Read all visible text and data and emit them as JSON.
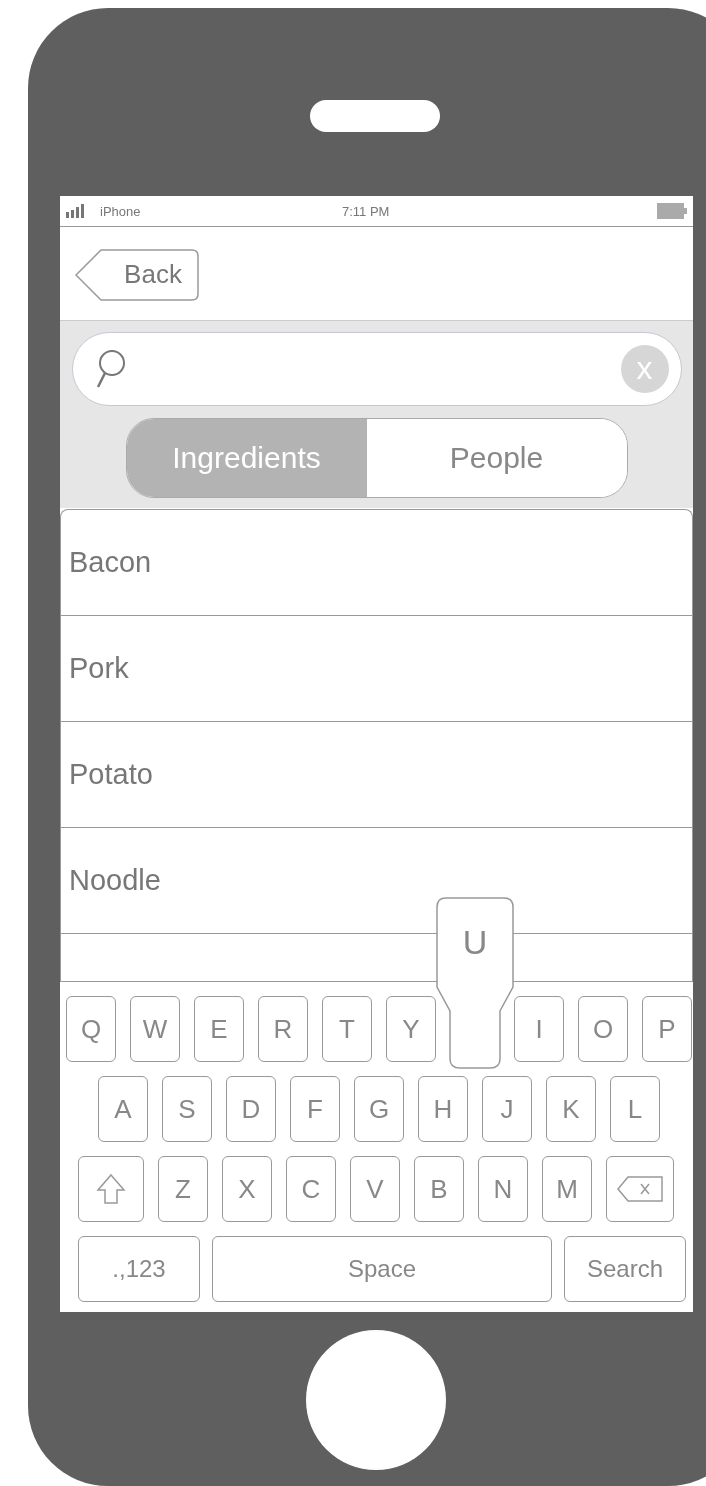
{
  "status_bar": {
    "carrier": "iPhone",
    "time": "7:11 PM"
  },
  "nav": {
    "back_label": "Back"
  },
  "search": {
    "clear_label": "x"
  },
  "segments": [
    {
      "label": "Ingredients",
      "selected": true
    },
    {
      "label": "People",
      "selected": false
    }
  ],
  "rows": [
    {
      "label": "Bacon"
    },
    {
      "label": "Pork"
    },
    {
      "label": "Potato"
    },
    {
      "label": "Noodle"
    }
  ],
  "keyboard": {
    "rows": [
      [
        {
          "kind": "letter",
          "label": "Q",
          "pressed": false
        },
        {
          "kind": "letter",
          "label": "W",
          "pressed": false
        },
        {
          "kind": "letter",
          "label": "E",
          "pressed": false
        },
        {
          "kind": "letter",
          "label": "R",
          "pressed": false
        },
        {
          "kind": "letter",
          "label": "T",
          "pressed": false
        },
        {
          "kind": "letter",
          "label": "Y",
          "pressed": false
        },
        {
          "kind": "letter",
          "label": "U",
          "pressed": true
        },
        {
          "kind": "letter",
          "label": "I",
          "pressed": false
        },
        {
          "kind": "letter",
          "label": "O",
          "pressed": false
        },
        {
          "kind": "letter",
          "label": "P",
          "pressed": false
        }
      ],
      [
        {
          "kind": "letter",
          "label": "A",
          "pressed": false
        },
        {
          "kind": "letter",
          "label": "S",
          "pressed": false
        },
        {
          "kind": "letter",
          "label": "D",
          "pressed": false
        },
        {
          "kind": "letter",
          "label": "F",
          "pressed": false
        },
        {
          "kind": "letter",
          "label": "G",
          "pressed": false
        },
        {
          "kind": "letter",
          "label": "H",
          "pressed": false
        },
        {
          "kind": "letter",
          "label": "J",
          "pressed": false
        },
        {
          "kind": "letter",
          "label": "K",
          "pressed": false
        },
        {
          "kind": "letter",
          "label": "L",
          "pressed": false
        }
      ],
      [
        {
          "kind": "shift"
        },
        {
          "kind": "letter",
          "label": "Z",
          "pressed": false
        },
        {
          "kind": "letter",
          "label": "X",
          "pressed": false
        },
        {
          "kind": "letter",
          "label": "C",
          "pressed": false
        },
        {
          "kind": "letter",
          "label": "V",
          "pressed": false
        },
        {
          "kind": "letter",
          "label": "B",
          "pressed": false
        },
        {
          "kind": "letter",
          "label": "N",
          "pressed": false
        },
        {
          "kind": "letter",
          "label": "M",
          "pressed": false
        },
        {
          "kind": "backspace"
        }
      ]
    ],
    "bottom_bar": {
      "numbers_label": ".,123",
      "space_label": "Space",
      "action_label": "Search"
    }
  }
}
